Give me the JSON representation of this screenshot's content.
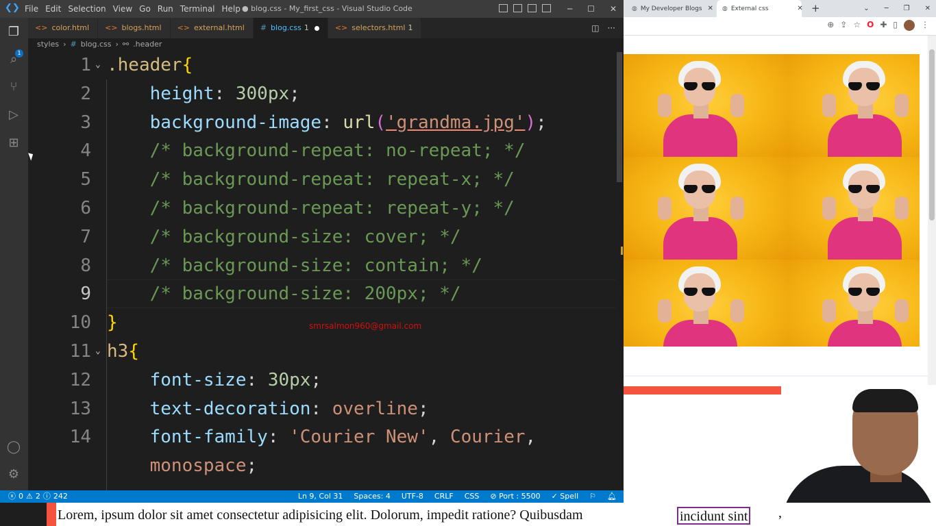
{
  "vscode": {
    "menu": [
      "File",
      "Edit",
      "Selection",
      "View",
      "Go",
      "Run",
      "Terminal",
      "Help"
    ],
    "window_title": "● blog.css - My_first_css - Visual Studio Code",
    "tabs": [
      {
        "label": "color.html",
        "type": "html"
      },
      {
        "label": "blogs.html",
        "type": "html"
      },
      {
        "label": "external.html",
        "type": "html"
      },
      {
        "label": "blog.css",
        "type": "css",
        "badge": "1",
        "active": true,
        "dirty": true
      },
      {
        "label": "selectors.html",
        "type": "html",
        "badge": "1"
      }
    ],
    "breadcrumb": [
      "styles",
      "blog.css",
      ".header"
    ],
    "explorer_badge": "1",
    "code_lines": [
      {
        "n": "1",
        "parts": [
          {
            "t": ".header",
            "c": "sel"
          },
          {
            "t": "{",
            "c": "brace"
          }
        ],
        "fold": true
      },
      {
        "n": "2",
        "parts": [
          {
            "t": "    height",
            "c": "prop"
          },
          {
            "t": ": ",
            "c": "punc"
          },
          {
            "t": "300px",
            "c": "num"
          },
          {
            "t": ";",
            "c": "punc"
          }
        ]
      },
      {
        "n": "3",
        "parts": [
          {
            "t": "    background-image",
            "c": "prop"
          },
          {
            "t": ": ",
            "c": "punc"
          },
          {
            "t": "url",
            "c": "fn"
          },
          {
            "t": "(",
            "c": "paren"
          },
          {
            "t": "'grandma.jpg'",
            "c": "str strline"
          },
          {
            "t": ")",
            "c": "paren"
          },
          {
            "t": ";",
            "c": "punc"
          }
        ]
      },
      {
        "n": "4",
        "parts": [
          {
            "t": "    /* background-repeat: no-repeat; */",
            "c": "cmt"
          }
        ]
      },
      {
        "n": "5",
        "parts": [
          {
            "t": "    /* background-repeat: repeat-x; */",
            "c": "cmt"
          }
        ]
      },
      {
        "n": "6",
        "parts": [
          {
            "t": "    /* background-repeat: repeat-y; */",
            "c": "cmt"
          }
        ]
      },
      {
        "n": "7",
        "parts": [
          {
            "t": "    /* background-size: cover; */",
            "c": "cmt"
          }
        ]
      },
      {
        "n": "8",
        "parts": [
          {
            "t": "    /* background-size: contain; */",
            "c": "cmt"
          }
        ]
      },
      {
        "n": "9",
        "parts": [
          {
            "t": "    /* background-size: 200px; */",
            "c": "cmt"
          }
        ],
        "current": true
      },
      {
        "n": "10",
        "parts": [
          {
            "t": "}",
            "c": "brace"
          }
        ]
      },
      {
        "n": "11",
        "parts": [
          {
            "t": "h3",
            "c": "sel"
          },
          {
            "t": "{",
            "c": "brace"
          }
        ],
        "fold": true
      },
      {
        "n": "12",
        "parts": [
          {
            "t": "    font-size",
            "c": "prop"
          },
          {
            "t": ": ",
            "c": "punc"
          },
          {
            "t": "30px",
            "c": "num"
          },
          {
            "t": ";",
            "c": "punc"
          }
        ]
      },
      {
        "n": "13",
        "parts": [
          {
            "t": "    text-decoration",
            "c": "prop"
          },
          {
            "t": ": ",
            "c": "punc"
          },
          {
            "t": "overline",
            "c": "val"
          },
          {
            "t": ";",
            "c": "punc"
          }
        ]
      },
      {
        "n": "14",
        "parts": [
          {
            "t": "    font-family",
            "c": "prop"
          },
          {
            "t": ": ",
            "c": "punc"
          },
          {
            "t": "'Courier New'",
            "c": "str"
          },
          {
            "t": ", ",
            "c": "punc"
          },
          {
            "t": "Courier",
            "c": "val"
          },
          {
            "t": ",",
            "c": "punc"
          }
        ]
      },
      {
        "n": "",
        "parts": [
          {
            "t": "    monospace",
            "c": "val"
          },
          {
            "t": ";",
            "c": "punc"
          }
        ]
      }
    ],
    "watermark": "smrsalmon960@gmail.com",
    "status": {
      "errors": "0",
      "warnings": "2",
      "infos": "242",
      "cursor": "Ln 9, Col 31",
      "spaces": "Spaces: 4",
      "encoding": "UTF-8",
      "eol": "CRLF",
      "language": "CSS",
      "port": "Port : 5500",
      "spell": "Spell"
    }
  },
  "browser": {
    "tabs": [
      {
        "label": "My Developer Blogs",
        "active": false
      },
      {
        "label": "External css",
        "active": true
      }
    ]
  },
  "page_text": {
    "lorem": "Lorem, ipsum dolor sit amet consectetur adipisicing elit. Dolorum, impedit ratione? Quibusdam",
    "boxed": "incidunt sint",
    "trail": ","
  },
  "colors": {
    "status_bar": "#007acc",
    "tile_bg": "#f6b413",
    "red_bar": "#f4543e",
    "box_border": "#7b2d8e"
  }
}
